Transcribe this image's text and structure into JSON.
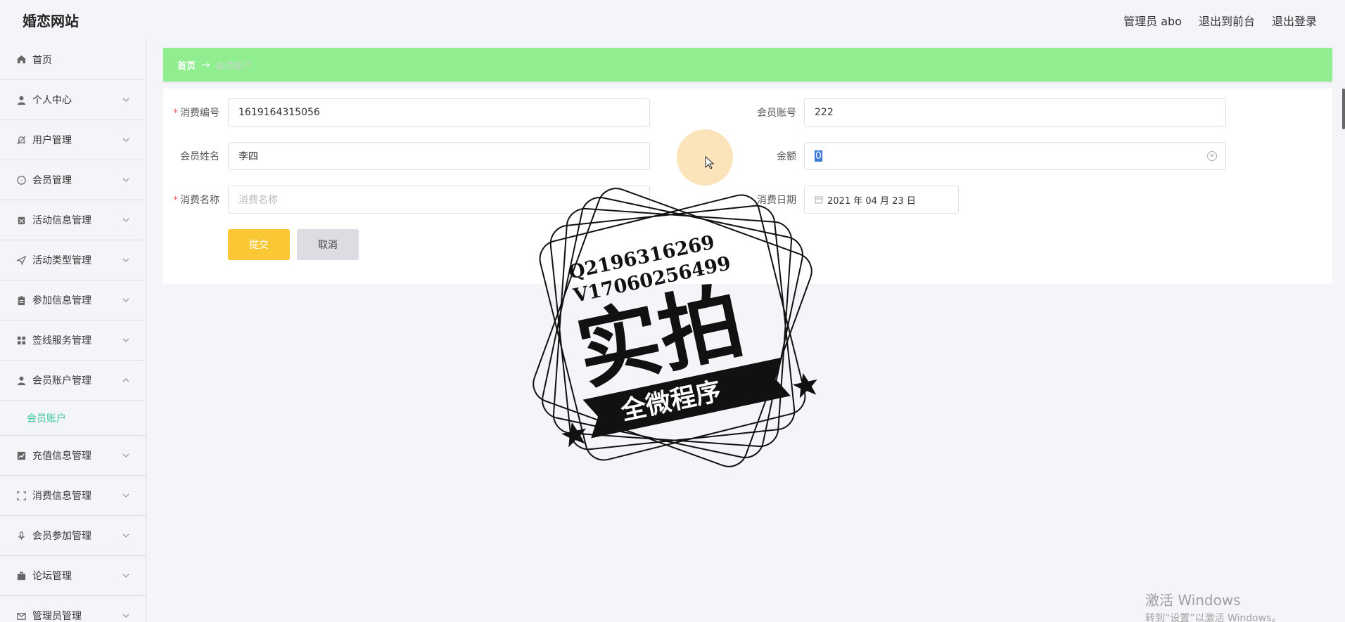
{
  "header": {
    "site_title": "婚恋网站",
    "admin_label": "管理员 abo",
    "back_to_front": "退出到前台",
    "logout": "退出登录"
  },
  "sidebar": {
    "items": [
      {
        "label": "首页",
        "icon": "home-icon",
        "expandable": false
      },
      {
        "label": "个人中心",
        "icon": "user-icon",
        "expandable": true
      },
      {
        "label": "用户管理",
        "icon": "bell-off-icon",
        "expandable": true
      },
      {
        "label": "会员管理",
        "icon": "compass-icon",
        "expandable": true
      },
      {
        "label": "活动信息管理",
        "icon": "calendar-icon",
        "expandable": true
      },
      {
        "label": "活动类型管理",
        "icon": "send-icon",
        "expandable": true
      },
      {
        "label": "参加信息管理",
        "icon": "clipboard-icon",
        "expandable": true
      },
      {
        "label": "签线服务管理",
        "icon": "grid-icon",
        "expandable": true
      },
      {
        "label": "会员账户管理",
        "icon": "user-icon",
        "expandable": true,
        "expanded": true
      },
      {
        "label": "充值信息管理",
        "icon": "chart-icon",
        "expandable": true
      },
      {
        "label": "消费信息管理",
        "icon": "fullscreen-icon",
        "expandable": true
      },
      {
        "label": "会员参加管理",
        "icon": "mic-icon",
        "expandable": true
      },
      {
        "label": "论坛管理",
        "icon": "briefcase-icon",
        "expandable": true
      },
      {
        "label": "管理员管理",
        "icon": "mail-icon",
        "expandable": true
      }
    ],
    "submenu_active": "会员账户"
  },
  "breadcrumb": {
    "home": "首页",
    "arrow": "→",
    "current": "会员账户"
  },
  "form": {
    "consume_no_label": "消费编号",
    "consume_no_value": "1619164315056",
    "member_account_label": "会员账号",
    "member_account_value": "222",
    "member_name_label": "会员姓名",
    "member_name_value": "李四",
    "amount_label": "金额",
    "amount_value": "0",
    "consume_name_label": "消费名称",
    "consume_name_placeholder": "消费名称",
    "consume_date_label": "消费日期",
    "consume_date_value": "2021 年 04 月 23 日",
    "submit_label": "提交",
    "cancel_label": "取消"
  },
  "watermark": {
    "line1": "Q2196316269",
    "line2": "V17060256499",
    "big_text": "实拍",
    "banner": "全微程序"
  },
  "windows_activation": {
    "title": "激活 Windows",
    "subtitle": "转到“设置”以激活 Windows。"
  },
  "colors": {
    "breadcrumb_bg": "#90ee90",
    "submit_bg": "#fbc735",
    "active_submenu": "#3ec6a0",
    "required": "#f56c6c"
  }
}
